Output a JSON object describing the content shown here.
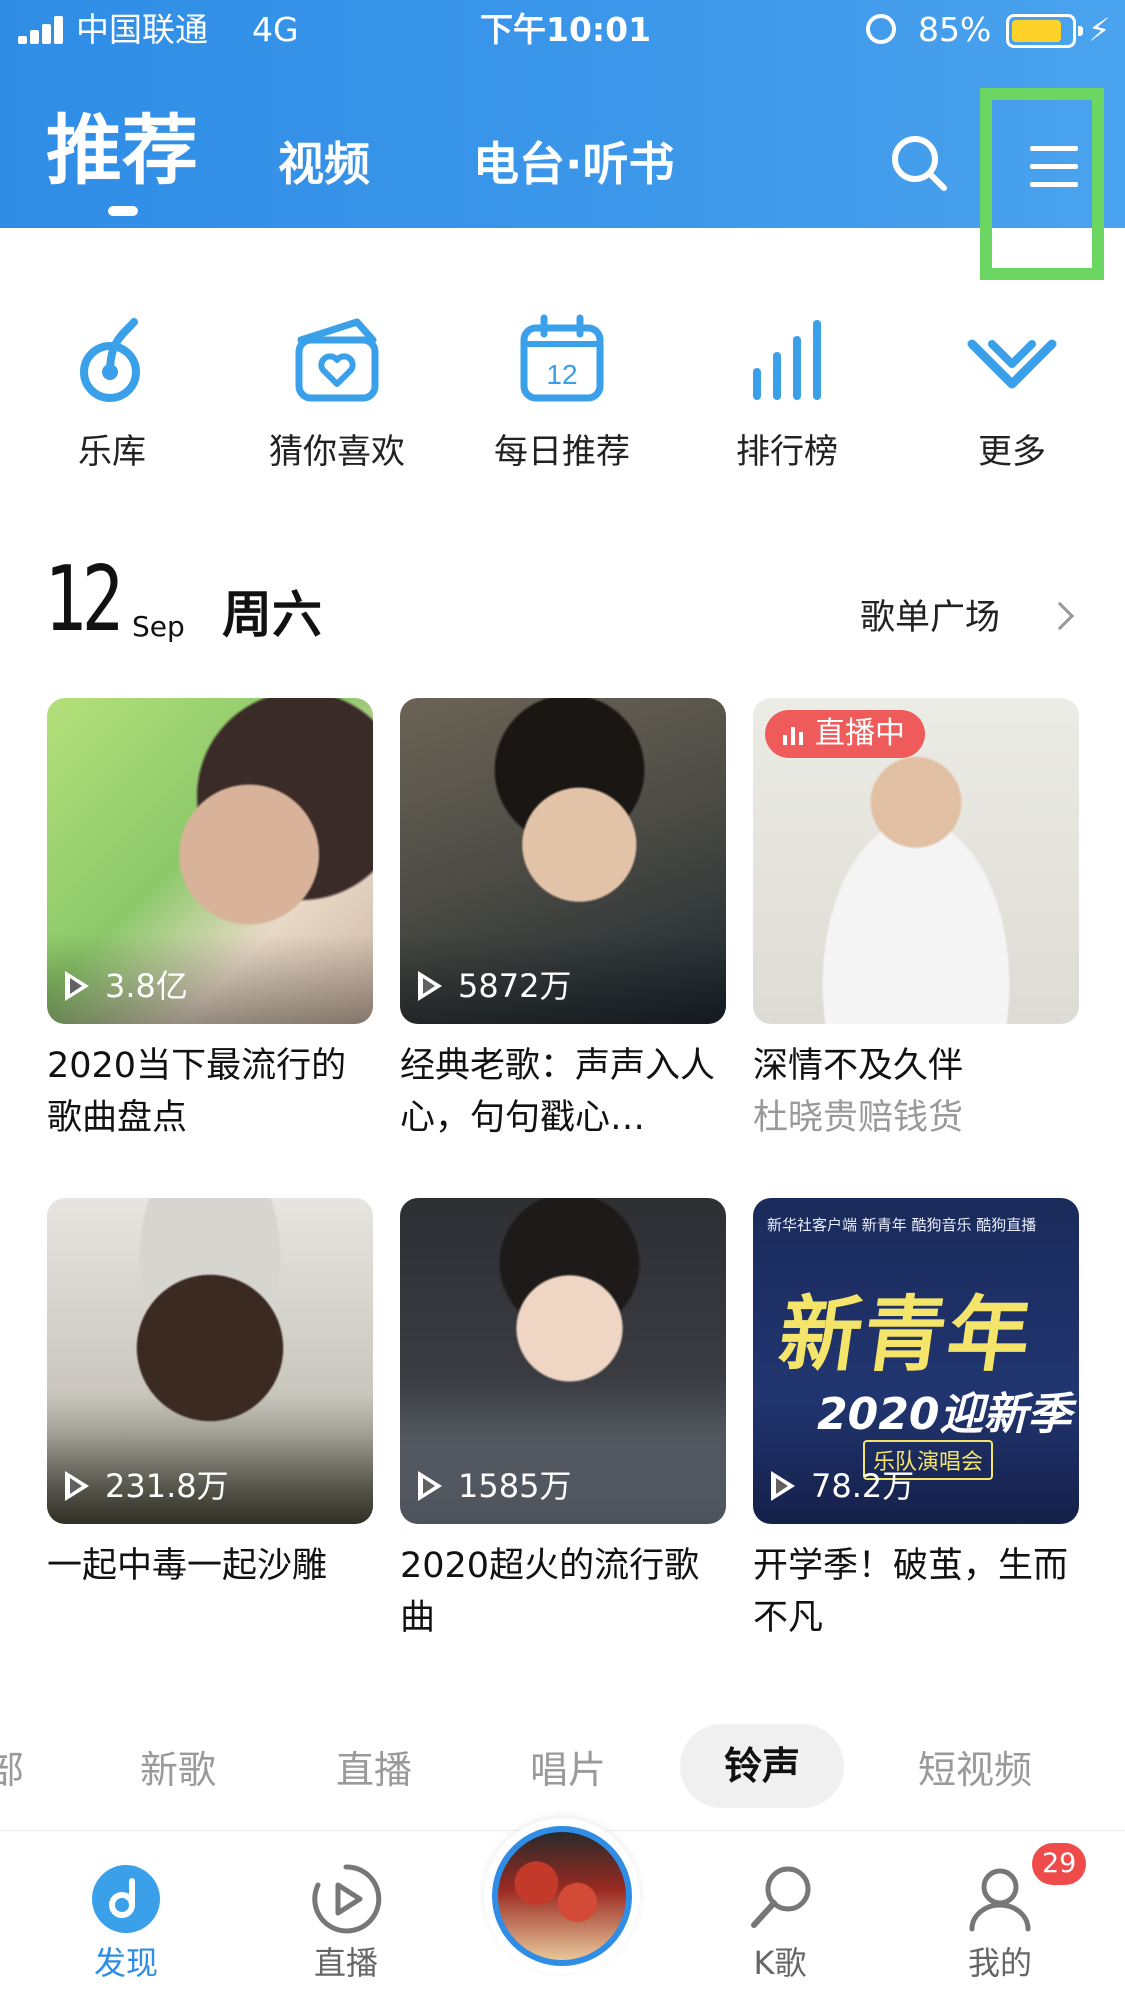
{
  "status_bar": {
    "carrier": "中国联通",
    "network": "4G",
    "time": "下午10:01",
    "battery": "85%",
    "battery_level": 0.85
  },
  "header": {
    "tabs": [
      {
        "label": "推荐",
        "active": true
      },
      {
        "label": "视频",
        "active": false
      },
      {
        "label": "电台·听书",
        "active": false
      }
    ],
    "search_icon": "search-icon",
    "menu_icon": "menu-icon"
  },
  "quick_entries": [
    {
      "label": "乐库",
      "icon": "music-note-icon"
    },
    {
      "label": "猜你喜欢",
      "icon": "heart-box-icon"
    },
    {
      "label": "每日推荐",
      "icon": "calendar-icon",
      "icon_text": "12"
    },
    {
      "label": "排行榜",
      "icon": "chart-bars-icon"
    },
    {
      "label": "更多",
      "icon": "chevron-down-icon"
    }
  ],
  "date_section": {
    "day": "12",
    "month": "Sep",
    "weekday": "周六",
    "more_link": "歌单广场"
  },
  "playlists": [
    {
      "title": "2020当下最流行的歌曲盘点",
      "plays": "3.8亿",
      "subtitle": "",
      "live": false
    },
    {
      "title": "经典老歌：声声入人心，句句戳心…",
      "plays": "5872万",
      "subtitle": "",
      "live": false
    },
    {
      "title": "深情不及久伴",
      "plays": "",
      "subtitle": "杜晓贵赔钱货",
      "live": true,
      "live_label": "直播中"
    },
    {
      "title": "一起中毒一起沙雕",
      "plays": "231.8万",
      "subtitle": "",
      "live": false
    },
    {
      "title": "2020超火的流行歌曲",
      "plays": "1585万",
      "subtitle": "",
      "live": false
    },
    {
      "title": "开学季！破茧，生而不凡",
      "plays": "78.2万",
      "subtitle": "",
      "live": false
    }
  ],
  "poster_text": {
    "top_line": "新华社客户端  新青年  酷狗音乐  酷狗直播",
    "big": "新青年",
    "mid": "2020迎新季",
    "band": "乐队演唱会"
  },
  "category_strip": [
    {
      "label": "部",
      "active": false
    },
    {
      "label": "新歌",
      "active": false
    },
    {
      "label": "直播",
      "active": false
    },
    {
      "label": "唱片",
      "active": false
    },
    {
      "label": "铃声",
      "active": true
    },
    {
      "label": "短视频",
      "active": false
    }
  ],
  "bottom_nav": [
    {
      "label": "发现",
      "icon": "discover-icon",
      "active": true
    },
    {
      "label": "直播",
      "icon": "live-play-icon",
      "active": false
    },
    {
      "label": "K歌",
      "icon": "microphone-icon",
      "active": false
    },
    {
      "label": "我的",
      "icon": "profile-icon",
      "active": false
    }
  ],
  "notification_count": "29",
  "colors": {
    "brand_blue": "#2f8de6",
    "badge_red": "#ef4b4b",
    "live_red": "#ef5a5a",
    "highlight_green": "#6bd661"
  }
}
